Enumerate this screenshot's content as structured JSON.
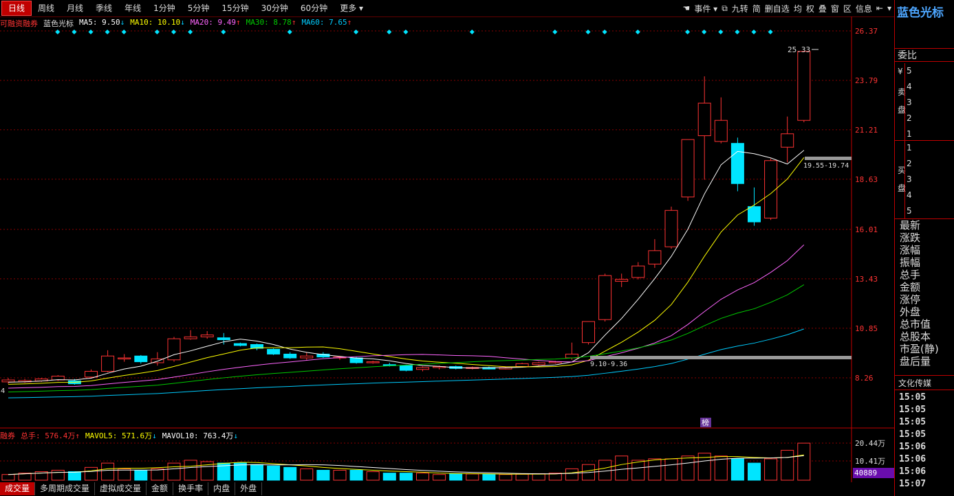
{
  "toolbar": {
    "tabs": [
      "日线",
      "周线",
      "月线",
      "季线",
      "年线",
      "1分钟",
      "5分钟",
      "15分钟",
      "30分钟",
      "60分钟",
      "更多"
    ],
    "right": [
      "事件",
      "九转",
      "简",
      "删自选",
      "均",
      "权",
      "叠",
      "窗",
      "区",
      "信息"
    ]
  },
  "legend": {
    "prefix": "可融资融券",
    "indicator": "蓝色光标",
    "ma5": "MA5: 9.50",
    "ma10": "MA10: 10.10",
    "ma20": "MA20: 9.49",
    "ma30": "MA30: 8.78",
    "ma60": "MA60: 7.65",
    "ma5_arrow": "↓",
    "ma10_arrow": "↓",
    "ma20_arrow": "↑",
    "ma30_arrow": "↑",
    "ma60_arrow": "↑"
  },
  "volume_legend": {
    "prefix": "融券",
    "total": "总手: 576.4万",
    "total_arrow": "↑",
    "mavol5": "MAVOL5: 571.6万",
    "mavol5_arrow": "↓",
    "mavol10": "MAVOL10: 763.4万",
    "mavol10_arrow": "↓"
  },
  "annotations": {
    "high_label": "25.33",
    "range_label_top": "19.55-19.74",
    "range_label_bottom": "9.10-9.36",
    "bang": "榜",
    "left_label": "4",
    "vol_box": "40889"
  },
  "colors": {
    "up": "#ff3333",
    "down": "#00e5ff",
    "ma5": "#ffffff",
    "ma10": "#ffff00",
    "ma20": "#ff66ff",
    "ma30": "#00cc00",
    "ma60": "#00ccff",
    "grid": "#8b0000"
  },
  "chart_data": {
    "type": "candlestick",
    "price_axis_ticks": [
      "26.37",
      "23.79",
      "21.21",
      "18.63",
      "16.01",
      "13.43",
      "10.85",
      "8.26"
    ],
    "volume_axis_ticks": [
      "20.44万",
      "10.41万"
    ],
    "candles": [
      {
        "o": 8.05,
        "c": 8.15,
        "h": 8.25,
        "l": 7.95
      },
      {
        "o": 8.05,
        "c": 8.12,
        "h": 8.2,
        "l": 8.0
      },
      {
        "o": 8.1,
        "c": 8.2,
        "h": 8.25,
        "l": 8.05
      },
      {
        "o": 8.15,
        "c": 8.35,
        "h": 8.4,
        "l": 8.1
      },
      {
        "o": 8.1,
        "c": 7.95,
        "h": 8.2,
        "l": 7.9
      },
      {
        "o": 8.3,
        "c": 8.6,
        "h": 8.7,
        "l": 8.25
      },
      {
        "o": 8.6,
        "c": 9.4,
        "h": 9.7,
        "l": 8.55
      },
      {
        "o": 9.3,
        "c": 9.3,
        "h": 9.5,
        "l": 9.1
      },
      {
        "o": 9.4,
        "c": 9.1,
        "h": 9.45,
        "l": 9.0
      },
      {
        "o": 9.05,
        "c": 9.25,
        "h": 9.6,
        "l": 8.9
      },
      {
        "o": 9.2,
        "c": 10.3,
        "h": 10.4,
        "l": 9.1
      },
      {
        "o": 10.3,
        "c": 10.4,
        "h": 10.75,
        "l": 10.25
      },
      {
        "o": 10.4,
        "c": 10.5,
        "h": 10.7,
        "l": 10.3
      },
      {
        "o": 10.35,
        "c": 10.25,
        "h": 10.6,
        "l": 10.0
      },
      {
        "o": 10.05,
        "c": 9.95,
        "h": 10.1,
        "l": 9.9
      },
      {
        "o": 10.0,
        "c": 9.8,
        "h": 10.05,
        "l": 9.7
      },
      {
        "o": 9.75,
        "c": 9.5,
        "h": 9.8,
        "l": 9.45
      },
      {
        "o": 9.5,
        "c": 9.3,
        "h": 9.6,
        "l": 9.25
      },
      {
        "o": 9.3,
        "c": 9.4,
        "h": 9.6,
        "l": 9.2
      },
      {
        "o": 9.5,
        "c": 9.35,
        "h": 9.6,
        "l": 9.3
      },
      {
        "o": 9.3,
        "c": 9.35,
        "h": 9.4,
        "l": 9.2
      },
      {
        "o": 9.3,
        "c": 9.05,
        "h": 9.35,
        "l": 9.0
      },
      {
        "o": 9.05,
        "c": 9.1,
        "h": 9.15,
        "l": 9.0
      },
      {
        "o": 8.95,
        "c": 8.9,
        "h": 9.05,
        "l": 8.85
      },
      {
        "o": 8.9,
        "c": 8.65,
        "h": 8.95,
        "l": 8.6
      },
      {
        "o": 8.7,
        "c": 8.8,
        "h": 8.85,
        "l": 8.6
      },
      {
        "o": 8.8,
        "c": 8.85,
        "h": 8.9,
        "l": 8.7
      },
      {
        "o": 8.85,
        "c": 8.75,
        "h": 8.9,
        "l": 8.7
      },
      {
        "o": 8.75,
        "c": 8.8,
        "h": 8.85,
        "l": 8.7
      },
      {
        "o": 8.8,
        "c": 8.72,
        "h": 8.85,
        "l": 8.7
      },
      {
        "o": 8.72,
        "c": 8.8,
        "h": 8.85,
        "l": 8.7
      },
      {
        "o": 8.85,
        "c": 9.0,
        "h": 9.05,
        "l": 8.8
      },
      {
        "o": 8.95,
        "c": 9.05,
        "h": 9.1,
        "l": 8.9
      },
      {
        "o": 9.05,
        "c": 9.1,
        "h": 9.15,
        "l": 9.0
      },
      {
        "o": 9.3,
        "c": 9.5,
        "h": 10.1,
        "l": 9.2
      },
      {
        "o": 10.1,
        "c": 11.2,
        "h": 11.2,
        "l": 10.0
      },
      {
        "o": 11.3,
        "c": 13.6,
        "h": 13.7,
        "l": 11.2
      },
      {
        "o": 13.3,
        "c": 13.4,
        "h": 13.7,
        "l": 13.0
      },
      {
        "o": 13.5,
        "c": 14.1,
        "h": 14.3,
        "l": 13.4
      },
      {
        "o": 14.2,
        "c": 14.9,
        "h": 15.5,
        "l": 14.0
      },
      {
        "o": 15.1,
        "c": 17.0,
        "h": 17.2,
        "l": 15.0
      },
      {
        "o": 17.7,
        "c": 20.7,
        "h": 20.7,
        "l": 17.5
      },
      {
        "o": 20.9,
        "c": 22.6,
        "h": 24.0,
        "l": 18.6
      },
      {
        "o": 20.6,
        "c": 21.7,
        "h": 22.9,
        "l": 20.5
      },
      {
        "o": 20.5,
        "c": 18.4,
        "h": 20.8,
        "l": 18.0
      },
      {
        "o": 17.2,
        "c": 16.4,
        "h": 18.2,
        "l": 16.2
      },
      {
        "o": 16.6,
        "c": 19.6,
        "h": 19.7,
        "l": 16.5
      },
      {
        "o": 20.3,
        "c": 21.0,
        "h": 21.9,
        "l": 19.5
      },
      {
        "o": 21.7,
        "c": 25.3,
        "h": 25.33,
        "l": 21.6
      }
    ],
    "volumes": [
      2,
      2.5,
      3,
      3.5,
      3,
      4.5,
      6,
      4,
      3.5,
      4,
      6,
      7,
      6.5,
      6,
      6,
      5.5,
      5,
      4.5,
      4,
      3.5,
      3.5,
      3.5,
      3,
      2.5,
      2.5,
      2.5,
      2,
      2.3,
      2.2,
      2.1,
      2,
      2.1,
      2.3,
      2.5,
      4,
      5.5,
      7,
      8.5,
      7,
      7.5,
      7.5,
      8.5,
      9.5,
      8.5,
      7.5,
      6,
      7.5,
      10.5,
      13
    ]
  },
  "panel": {
    "title": "蓝色光标",
    "weibi": "委比",
    "yuan": "¥",
    "sell_label": [
      "卖",
      "盘"
    ],
    "buy_label": [
      "买",
      "盘"
    ],
    "sell_levels": [
      "5",
      "4",
      "3",
      "2",
      "1"
    ],
    "buy_levels": [
      "1",
      "2",
      "3",
      "4",
      "5"
    ],
    "fields": [
      "最新",
      "涨跌",
      "涨幅",
      "振幅",
      "总手",
      "金额",
      "涨停",
      "外盘",
      "总市值",
      "总股本",
      "市盈(静)",
      "盘后量"
    ],
    "ticker_title": "文化传媒",
    "times": [
      "15:05",
      "15:05",
      "15:05",
      "15:05",
      "15:06",
      "15:06",
      "15:06",
      "15:07"
    ]
  },
  "bottom_tabs": [
    "成交量",
    "多周期成交量",
    "虚拟成交量",
    "金额",
    "换手率",
    "内盘",
    "外盘"
  ]
}
